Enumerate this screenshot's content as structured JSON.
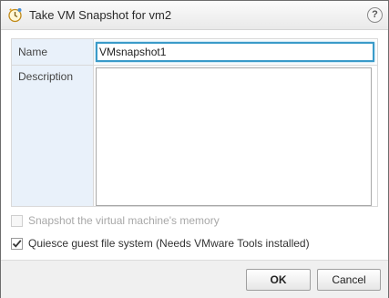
{
  "window": {
    "title": "Take VM Snapshot for vm2",
    "help_label": "?"
  },
  "form": {
    "name_label": "Name",
    "name_value": "VMsnapshot1",
    "description_label": "Description",
    "description_value": ""
  },
  "options": {
    "memory_label": "Snapshot the virtual machine's memory",
    "memory_checked": false,
    "memory_enabled": false,
    "quiesce_label": "Quiesce guest file system (Needs VMware Tools installed)",
    "quiesce_checked": true,
    "quiesce_enabled": true
  },
  "buttons": {
    "ok_label": "OK",
    "cancel_label": "Cancel"
  },
  "icons": {
    "title": "snapshot-clock-icon",
    "help": "help-icon",
    "check": "checkmark-icon"
  },
  "colors": {
    "label_column_bg": "#e9f1fa",
    "focus_border": "#3a9bc9",
    "footer_bg": "#f0f0f0"
  }
}
